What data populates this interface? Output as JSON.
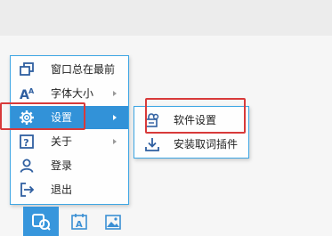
{
  "menu": {
    "items": [
      {
        "label": "窗口总在最前",
        "icon": "window-stack-icon"
      },
      {
        "label": "字体大小",
        "icon": "font-size-icon"
      },
      {
        "label": "设置",
        "icon": "gear-icon"
      },
      {
        "label": "关于",
        "icon": "help-icon"
      },
      {
        "label": "登录",
        "icon": "user-icon"
      },
      {
        "label": "退出",
        "icon": "exit-icon"
      }
    ]
  },
  "submenu": {
    "items": [
      {
        "label": "软件设置",
        "icon": "settings-tool-icon"
      },
      {
        "label": "安装取词插件",
        "icon": "download-icon"
      }
    ]
  },
  "bottom_bar": {
    "buttons": [
      {
        "icon": "dictionary-icon",
        "active": true
      },
      {
        "icon": "text-icon",
        "active": false
      },
      {
        "icon": "image-icon",
        "active": false
      }
    ]
  },
  "colors": {
    "accent": "#3292d8",
    "border": "#3ea6e4",
    "highlight": "#d83a3a"
  }
}
